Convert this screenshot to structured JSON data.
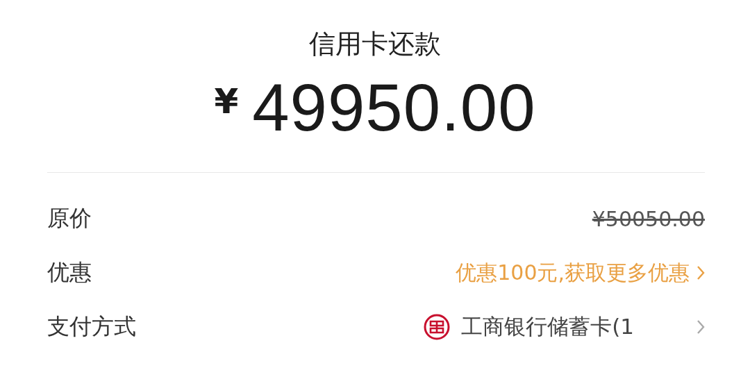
{
  "title": "信用卡还款",
  "amount": {
    "currency": "¥",
    "value": "49950.00"
  },
  "rows": [
    {
      "kind": "strike",
      "label": "原价",
      "value": "¥50050.00"
    },
    {
      "kind": "promo",
      "label": "优惠",
      "value": "优惠100元,获取更多优惠"
    },
    {
      "kind": "payment",
      "label": "支付方式",
      "value": "工商银行储蓄卡(1"
    }
  ]
}
